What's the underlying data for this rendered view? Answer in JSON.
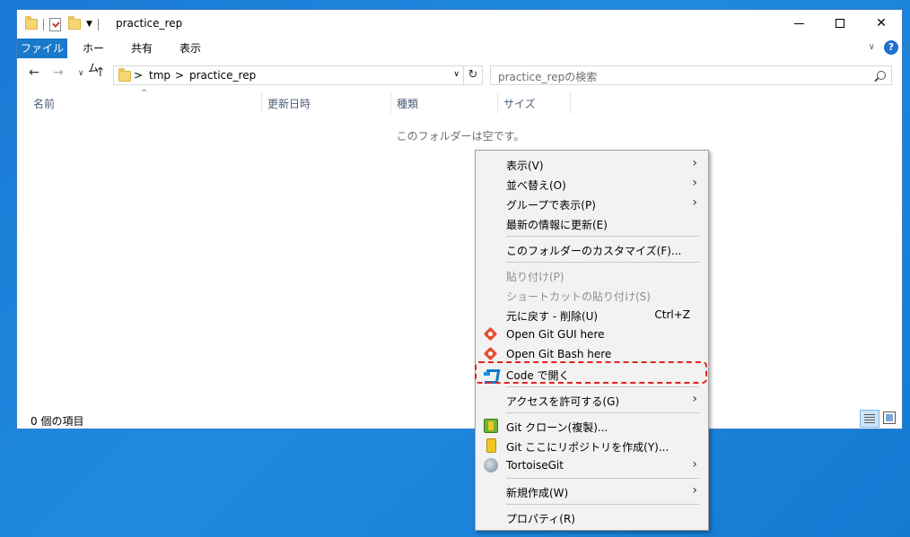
{
  "window": {
    "title": "practice_rep",
    "tabs": {
      "file": "ファイル",
      "home": "ホーム",
      "share": "共有",
      "view": "表示"
    },
    "help_label": "?"
  },
  "nav": {
    "breadcrumb": [
      "tmp",
      "practice_rep"
    ],
    "separator": ">",
    "search_placeholder": "practice_repの検索"
  },
  "columns": [
    "名前",
    "更新日時",
    "種類",
    "サイズ"
  ],
  "empty_message": "このフォルダーは空です。",
  "status": {
    "item_count": "0 個の項目"
  },
  "context_menu": {
    "items": [
      {
        "label": "表示(V)",
        "submenu": true
      },
      {
        "label": "並べ替え(O)",
        "submenu": true
      },
      {
        "label": "グループで表示(P)",
        "submenu": true
      },
      {
        "label": "最新の情報に更新(E)"
      },
      {
        "label": "このフォルダーのカスタマイズ(F)..."
      },
      {
        "label": "貼り付け(P)",
        "disabled": true
      },
      {
        "label": "ショートカットの貼り付け(S)",
        "disabled": true
      },
      {
        "label": "元に戻す - 削除(U)",
        "accel": "Ctrl+Z"
      },
      {
        "label": "Open Git GUI here",
        "icon": "git-icon"
      },
      {
        "label": "Open Git Bash here",
        "icon": "git-icon"
      },
      {
        "label": "Code で開く",
        "icon": "vscode-icon",
        "highlighted": true
      },
      {
        "label": "アクセスを許可する(G)",
        "submenu": true
      },
      {
        "label": "Git クローン(複製)...",
        "icon": "tortoisegit-clone-icon"
      },
      {
        "label": "Git ここにリポジトリを作成(Y)...",
        "icon": "tortoisegit-create-icon"
      },
      {
        "label": "TortoiseGit",
        "icon": "tortoisegit-icon",
        "submenu": true
      },
      {
        "label": "新規作成(W)",
        "submenu": true
      },
      {
        "label": "プロパティ(R)"
      }
    ]
  },
  "colors": {
    "accent": "#1979ca",
    "highlight_border": "#e02222",
    "desktop": "#1a78d4"
  }
}
